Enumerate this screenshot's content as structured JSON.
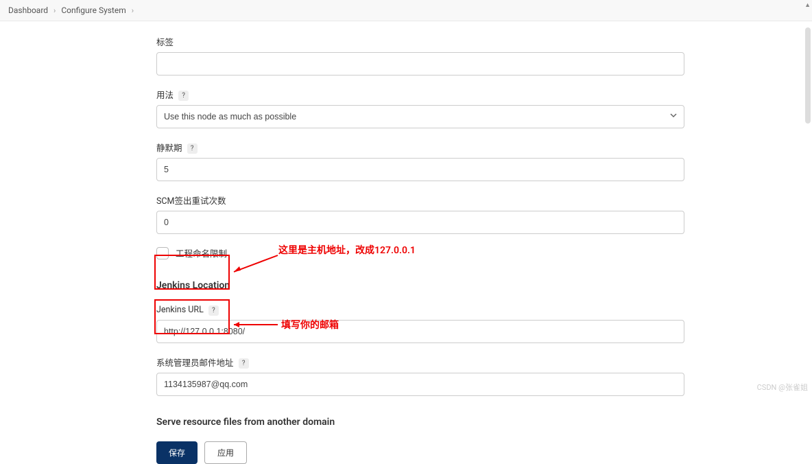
{
  "breadcrumb": {
    "items": [
      "Dashboard",
      "Configure System"
    ]
  },
  "form": {
    "labels_label": "标签",
    "labels_value": "",
    "usage_label": "用法",
    "usage_selected": "Use this node as much as possible",
    "quiet_label": "静默期",
    "quiet_value": "5",
    "scm_label": "SCM签出重试次数",
    "scm_value": "0",
    "naming_label": "工程命名限制"
  },
  "jenkins": {
    "section_title": "Jenkins Location",
    "url_label": "Jenkins URL",
    "url_value": "http://127.0.0.1:8080/",
    "admin_label": "系统管理员邮件地址",
    "admin_value": "1134135987@qq.com"
  },
  "serve": {
    "section_title": "Serve resource files from another domain"
  },
  "annotations": {
    "a1": "这里是主机地址，改成127.0.0.1",
    "a2": "填写你的邮箱"
  },
  "buttons": {
    "save": "保存",
    "apply": "应用"
  },
  "watermark": "CSDN @张雀姐"
}
